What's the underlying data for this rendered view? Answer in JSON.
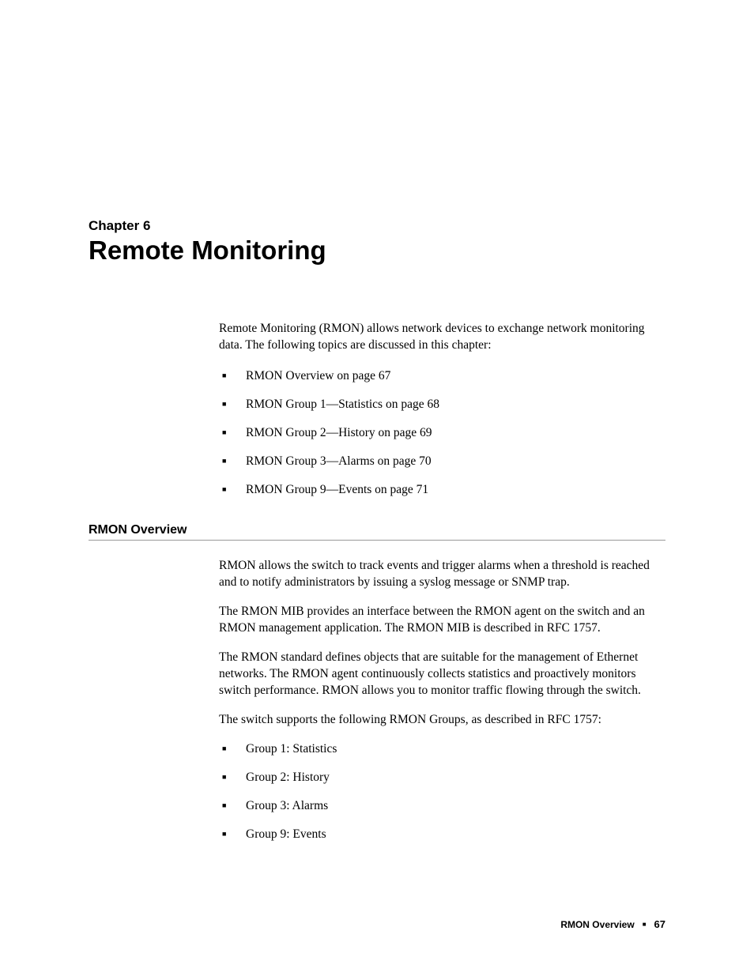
{
  "chapter": {
    "label": "Chapter 6",
    "title": "Remote Monitoring"
  },
  "intro": "Remote Monitoring (RMON) allows network devices to exchange network monitoring data. The following topics are discussed in this chapter:",
  "topics": [
    "RMON Overview on page 67",
    "RMON Group 1—Statistics on page 68",
    "RMON Group 2—History on page 69",
    "RMON Group 3—Alarms on page 70",
    "RMON Group 9—Events on page 71"
  ],
  "section": {
    "heading": "RMON Overview",
    "paras": [
      "RMON allows the switch to track events and trigger alarms when a threshold is reached and to notify administrators by issuing a syslog message or SNMP trap.",
      "The RMON MIB provides an interface between the RMON agent on the switch and an RMON management application. The RMON MIB is described in RFC 1757.",
      "The RMON standard defines objects that are suitable for the management of Ethernet networks. The RMON agent continuously collects statistics and proactively monitors switch performance. RMON allows you to monitor traffic flowing through the switch.",
      "The switch supports the following RMON Groups, as described in RFC 1757:"
    ],
    "groups": [
      "Group 1: Statistics",
      "Group 2: History",
      "Group 3: Alarms",
      "Group 9: Events"
    ]
  },
  "footer": {
    "section": "RMON Overview",
    "page": "67"
  }
}
